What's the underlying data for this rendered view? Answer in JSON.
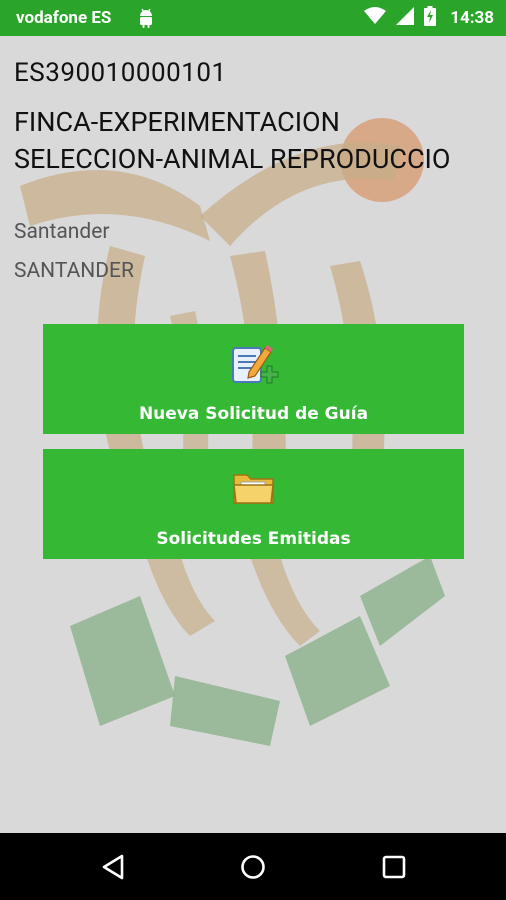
{
  "status_bar": {
    "carrier": "vodafone ES",
    "time": "14:38",
    "icons": [
      "android-icon",
      "wifi-icon",
      "signal-icon",
      "battery-charging-icon"
    ]
  },
  "farm": {
    "code": "ES390010000101",
    "name": "FINCA-EXPERIMENTACION SELECCION-ANIMAL REPRODUCCIO",
    "city": "Santander",
    "province": "SANTANDER"
  },
  "actions": [
    {
      "label": "Nueva Solicitud de Guía",
      "icon": "new-document-edit-icon"
    },
    {
      "label": "Solicitudes Emitidas",
      "icon": "folder-icon"
    }
  ],
  "nav_bar": {
    "icons": [
      "back-icon",
      "home-icon",
      "recent-apps-icon"
    ]
  },
  "colors": {
    "status_bar": "#2aa52a",
    "button": "#35b935",
    "background": "#d9d9d9"
  }
}
